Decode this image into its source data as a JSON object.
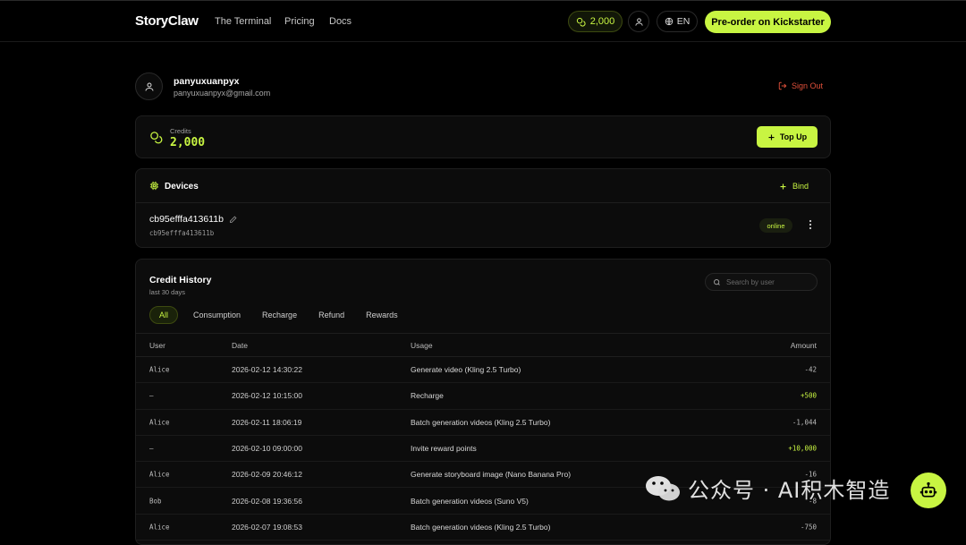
{
  "nav": {
    "logo": "StoryClaw",
    "links": [
      "The Terminal",
      "Pricing",
      "Docs"
    ],
    "credits": "2,000",
    "lang": "EN",
    "cta": "Pre-order on Kickstarter"
  },
  "profile": {
    "username": "panyuxuanpyx",
    "email": "panyuxuanpyx@gmail.com",
    "sign_out": "Sign Out"
  },
  "credits": {
    "label": "Credits",
    "value": "2,000",
    "top_up": "Top Up"
  },
  "devices": {
    "title": "Devices",
    "bind": "Bind",
    "items": [
      {
        "name": "cb95efffa413611b",
        "id": "cb95efffa413611b",
        "status": "online"
      }
    ]
  },
  "history": {
    "title": "Credit History",
    "subtitle": "last 30 days",
    "search_placeholder": "Search by user",
    "tabs": [
      "All",
      "Consumption",
      "Recharge",
      "Refund",
      "Rewards"
    ],
    "active_tab": "All",
    "columns": [
      "User",
      "Date",
      "Usage",
      "Amount"
    ],
    "rows": [
      {
        "user": "Alice",
        "date": "2026-02-12 14:30:22",
        "usage": "Generate video (Kling 2.5 Turbo)",
        "amount": "-42",
        "positive": false
      },
      {
        "user": "—",
        "date": "2026-02-12 10:15:00",
        "usage": "Recharge",
        "amount": "+500",
        "positive": true
      },
      {
        "user": "Alice",
        "date": "2026-02-11 18:06:19",
        "usage": "Batch generation videos (Kling 2.5 Turbo)",
        "amount": "-1,044",
        "positive": false
      },
      {
        "user": "—",
        "date": "2026-02-10 09:00:00",
        "usage": "Invite reward points",
        "amount": "+10,000",
        "positive": true
      },
      {
        "user": "Alice",
        "date": "2026-02-09 20:46:12",
        "usage": "Generate storyboard image (Nano Banana Pro)",
        "amount": "-16",
        "positive": false
      },
      {
        "user": "Bob",
        "date": "2026-02-08 19:36:56",
        "usage": "Batch generation videos (Suno V5)",
        "amount": "-8",
        "positive": false
      },
      {
        "user": "Alice",
        "date": "2026-02-07 19:08:53",
        "usage": "Batch generation videos (Kling 2.5 Turbo)",
        "amount": "-750",
        "positive": false
      }
    ]
  },
  "watermark": "公众号 · AI积木智造",
  "colors": {
    "accent": "#c8f542",
    "danger": "#e0503a",
    "bg": "#000000",
    "card": "#0c0c0c"
  }
}
